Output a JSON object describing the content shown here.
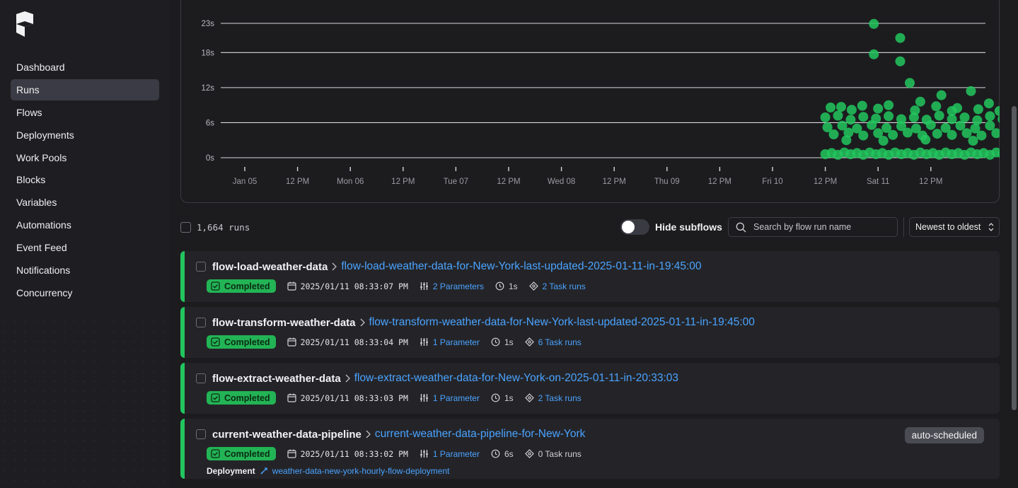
{
  "sidebar": {
    "items": [
      {
        "label": "Dashboard",
        "active": false
      },
      {
        "label": "Runs",
        "active": true
      },
      {
        "label": "Flows",
        "active": false
      },
      {
        "label": "Deployments",
        "active": false
      },
      {
        "label": "Work Pools",
        "active": false
      },
      {
        "label": "Blocks",
        "active": false
      },
      {
        "label": "Variables",
        "active": false
      },
      {
        "label": "Automations",
        "active": false
      },
      {
        "label": "Event Feed",
        "active": false
      },
      {
        "label": "Notifications",
        "active": false
      },
      {
        "label": "Concurrency",
        "active": false
      }
    ]
  },
  "chart_data": {
    "type": "scatter",
    "title": "",
    "xlabel": "",
    "ylabel": "",
    "y_ticks": [
      "23s",
      "18s",
      "12s",
      "6s",
      "0s"
    ],
    "y_tick_values": [
      23,
      18,
      12,
      6,
      0
    ],
    "x_ticks": [
      "Jan 05",
      "12 PM",
      "Mon 06",
      "12 PM",
      "Tue 07",
      "12 PM",
      "Wed 08",
      "12 PM",
      "Thu 09",
      "12 PM",
      "Fri 10",
      "12 PM",
      "Sat 11",
      "12 PM"
    ],
    "ylim": [
      0,
      23
    ],
    "point_color": "#22c55e",
    "grid": true,
    "series": [
      {
        "unit": "seconds",
        "x_unit": "days since Jan 05 00:00",
        "points": [
          [
            5.96,
            22.9
          ],
          [
            6.21,
            20.5
          ],
          [
            5.96,
            17.7
          ],
          [
            6.21,
            16.5
          ],
          [
            6.3,
            12.8
          ],
          [
            6.6,
            10.7
          ],
          [
            6.88,
            11.4
          ],
          [
            7.3,
            11.8
          ],
          [
            7.41,
            10.9
          ],
          [
            7.48,
            10.0
          ],
          [
            6.4,
            9.6
          ],
          [
            6.55,
            8.8
          ],
          [
            6.75,
            8.5
          ],
          [
            7.05,
            9.3
          ],
          [
            7.25,
            8.9
          ],
          [
            7.55,
            8.6
          ],
          [
            7.8,
            9.1
          ],
          [
            6.1,
            9.0
          ],
          [
            5.85,
            8.9
          ],
          [
            5.55,
            8.6
          ],
          [
            5.65,
            8.7
          ],
          [
            5.75,
            8.2
          ],
          [
            6.0,
            8.4
          ],
          [
            6.35,
            8.1
          ],
          [
            6.7,
            8.0
          ],
          [
            6.95,
            8.3
          ],
          [
            7.15,
            8.0
          ],
          [
            7.4,
            8.1
          ],
          [
            7.65,
            8.4
          ],
          [
            7.72,
            7.9
          ],
          [
            5.5,
            6.9
          ],
          [
            5.62,
            7.2
          ],
          [
            5.74,
            6.5
          ],
          [
            5.86,
            7.0
          ],
          [
            5.98,
            6.7
          ],
          [
            6.1,
            7.1
          ],
          [
            6.22,
            6.6
          ],
          [
            6.34,
            6.9
          ],
          [
            6.46,
            6.5
          ],
          [
            6.58,
            7.2
          ],
          [
            6.7,
            6.6
          ],
          [
            6.82,
            6.9
          ],
          [
            6.94,
            6.4
          ],
          [
            7.06,
            7.1
          ],
          [
            7.18,
            6.6
          ],
          [
            7.3,
            6.9
          ],
          [
            7.42,
            6.4
          ],
          [
            7.54,
            7.1
          ],
          [
            7.66,
            6.7
          ],
          [
            7.78,
            6.9
          ],
          [
            5.52,
            5.2
          ],
          [
            5.66,
            5.5
          ],
          [
            5.8,
            5.0
          ],
          [
            5.94,
            5.6
          ],
          [
            6.08,
            5.1
          ],
          [
            6.22,
            5.4
          ],
          [
            6.36,
            5.0
          ],
          [
            6.5,
            5.6
          ],
          [
            6.64,
            5.1
          ],
          [
            6.78,
            5.5
          ],
          [
            6.92,
            5.0
          ],
          [
            7.06,
            5.5
          ],
          [
            7.2,
            5.1
          ],
          [
            7.34,
            5.4
          ],
          [
            7.48,
            5.0
          ],
          [
            7.62,
            5.5
          ],
          [
            7.76,
            5.2
          ],
          [
            5.58,
            4.0
          ],
          [
            5.72,
            4.3
          ],
          [
            5.86,
            3.8
          ],
          [
            6.0,
            4.2
          ],
          [
            6.14,
            3.9
          ],
          [
            6.28,
            4.3
          ],
          [
            6.42,
            3.8
          ],
          [
            6.56,
            4.1
          ],
          [
            6.7,
            3.9
          ],
          [
            6.84,
            4.2
          ],
          [
            6.98,
            3.8
          ],
          [
            7.12,
            4.2
          ],
          [
            7.26,
            3.9
          ],
          [
            7.4,
            4.1
          ],
          [
            7.54,
            3.8
          ],
          [
            7.68,
            4.2
          ],
          [
            7.8,
            3.9
          ],
          [
            5.7,
            3.0
          ],
          [
            6.05,
            2.9
          ],
          [
            6.45,
            3.1
          ],
          [
            6.9,
            2.9
          ],
          [
            7.35,
            3.0
          ],
          [
            7.8,
            2.6
          ],
          [
            5.5,
            0.6
          ],
          [
            5.56,
            0.8
          ],
          [
            5.62,
            0.5
          ],
          [
            5.68,
            0.9
          ],
          [
            5.74,
            0.6
          ],
          [
            5.8,
            0.8
          ],
          [
            5.86,
            0.5
          ],
          [
            5.92,
            0.9
          ],
          [
            5.98,
            0.6
          ],
          [
            6.04,
            0.8
          ],
          [
            6.1,
            0.5
          ],
          [
            6.16,
            0.9
          ],
          [
            6.22,
            0.6
          ],
          [
            6.28,
            0.8
          ],
          [
            6.34,
            0.5
          ],
          [
            6.4,
            0.9
          ],
          [
            6.46,
            0.6
          ],
          [
            6.52,
            0.8
          ],
          [
            6.58,
            0.5
          ],
          [
            6.64,
            0.9
          ],
          [
            6.7,
            0.6
          ],
          [
            6.76,
            0.8
          ],
          [
            6.82,
            0.5
          ],
          [
            6.88,
            0.9
          ],
          [
            6.94,
            0.6
          ],
          [
            7.0,
            0.8
          ],
          [
            7.06,
            0.5
          ],
          [
            7.12,
            0.9
          ],
          [
            7.18,
            0.6
          ],
          [
            7.24,
            0.8
          ],
          [
            7.3,
            0.5
          ],
          [
            7.36,
            0.9
          ],
          [
            7.42,
            0.6
          ],
          [
            7.48,
            0.8
          ],
          [
            7.54,
            0.5
          ],
          [
            7.6,
            0.9
          ],
          [
            7.66,
            0.6
          ],
          [
            7.72,
            0.8
          ],
          [
            7.78,
            0.5
          ],
          [
            7.84,
            0.8
          ]
        ]
      }
    ]
  },
  "toolbar": {
    "run_count": "1,664  runs",
    "hide_subflows_label": "Hide subflows",
    "hide_subflows_on": false,
    "search_placeholder": "Search by flow run name",
    "sort_label": "Newest to oldest"
  },
  "runs": [
    {
      "flow_name": "flow-load-weather-data",
      "run_name": "flow-load-weather-data-for-New-York-last-updated-2025-01-11-in-19:45:00",
      "status": "Completed",
      "timestamp": "2025/01/11 08:33:07 PM",
      "parameters": "2 Parameters",
      "duration": "1s",
      "task_runs": "2 Task runs",
      "task_runs_link": true
    },
    {
      "flow_name": "flow-transform-weather-data",
      "run_name": "flow-transform-weather-data-for-New-York-last-updated-2025-01-11-in-19:45:00",
      "status": "Completed",
      "timestamp": "2025/01/11 08:33:04 PM",
      "parameters": "1 Parameter",
      "duration": "1s",
      "task_runs": "6 Task runs",
      "task_runs_link": true
    },
    {
      "flow_name": "flow-extract-weather-data",
      "run_name": "flow-extract-weather-data-for-New-York-on-2025-01-11-in-20:33:03",
      "status": "Completed",
      "timestamp": "2025/01/11 08:33:03 PM",
      "parameters": "1 Parameter",
      "duration": "1s",
      "task_runs": "2 Task runs",
      "task_runs_link": true
    },
    {
      "flow_name": "current-weather-data-pipeline",
      "run_name": "current-weather-data-pipeline-for-New-York",
      "status": "Completed",
      "timestamp": "2025/01/11 08:33:02 PM",
      "parameters": "1 Parameter",
      "duration": "6s",
      "task_runs": "0 Task runs",
      "task_runs_link": false,
      "tag": "auto-scheduled",
      "deployment_label": "Deployment",
      "deployment_name": "weather-data-new-york-hourly-flow-deployment"
    }
  ]
}
